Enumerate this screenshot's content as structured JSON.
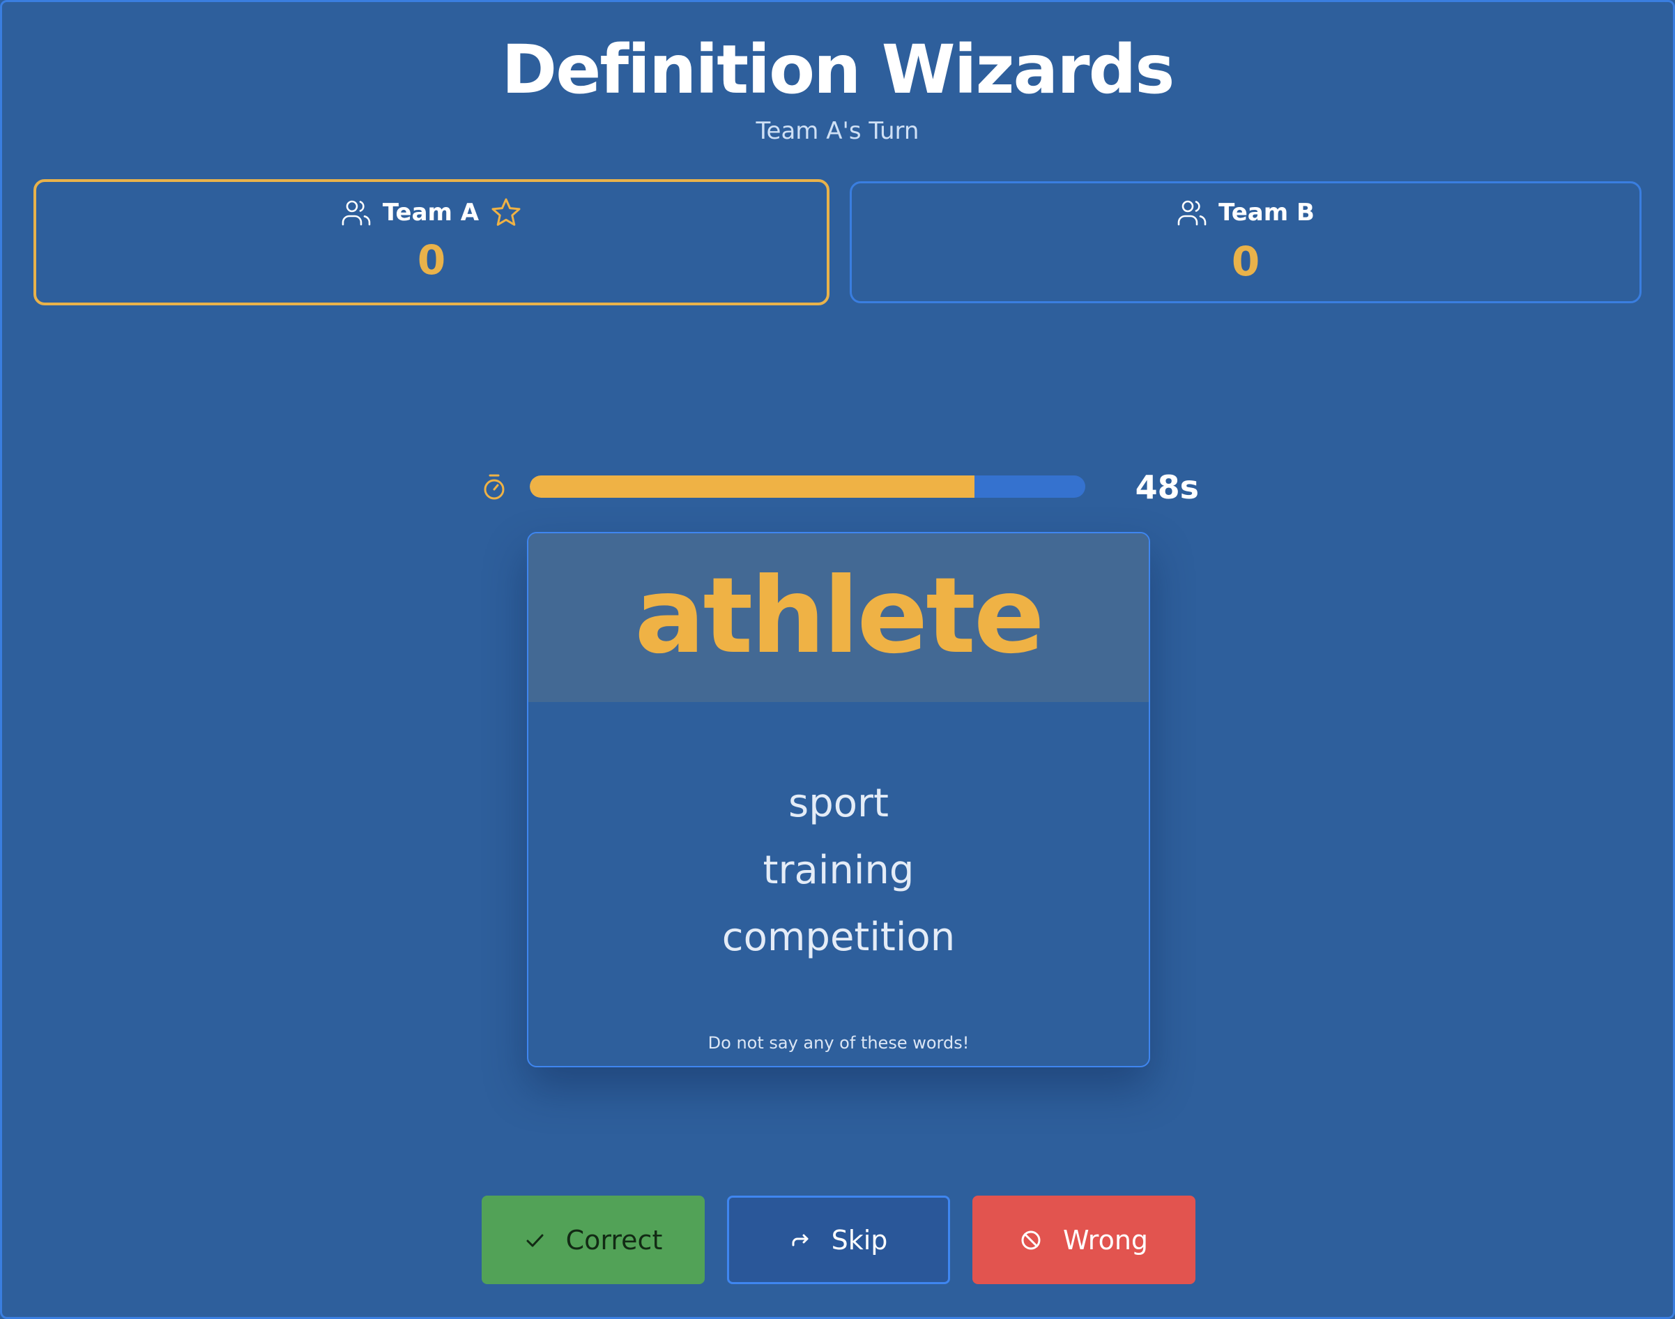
{
  "header": {
    "title": "Definition Wizards",
    "turn": "Team A's Turn"
  },
  "teams": [
    {
      "name": "Team A",
      "score": "0",
      "active": true,
      "icon": "users-icon",
      "badge_icon": "star-icon"
    },
    {
      "name": "Team B",
      "score": "0",
      "active": false,
      "icon": "users-icon"
    }
  ],
  "timer": {
    "icon": "stopwatch-icon",
    "label": "48s",
    "progress_fraction": 0.8
  },
  "card": {
    "word": "athlete",
    "taboo_words": [
      "sport",
      "training",
      "competition"
    ],
    "note": "Do not say any of these words!"
  },
  "actions": {
    "correct": {
      "label": "Correct",
      "icon": "check-icon",
      "color": "#52a257"
    },
    "skip": {
      "label": "Skip",
      "icon": "redo-arrow-icon",
      "color": "#2a5799"
    },
    "wrong": {
      "label": "Wrong",
      "icon": "ban-icon",
      "color": "#e2544f"
    }
  },
  "colors": {
    "background": "#2e5f9c",
    "accent": "#efb245",
    "border": "#3a7ee0"
  }
}
